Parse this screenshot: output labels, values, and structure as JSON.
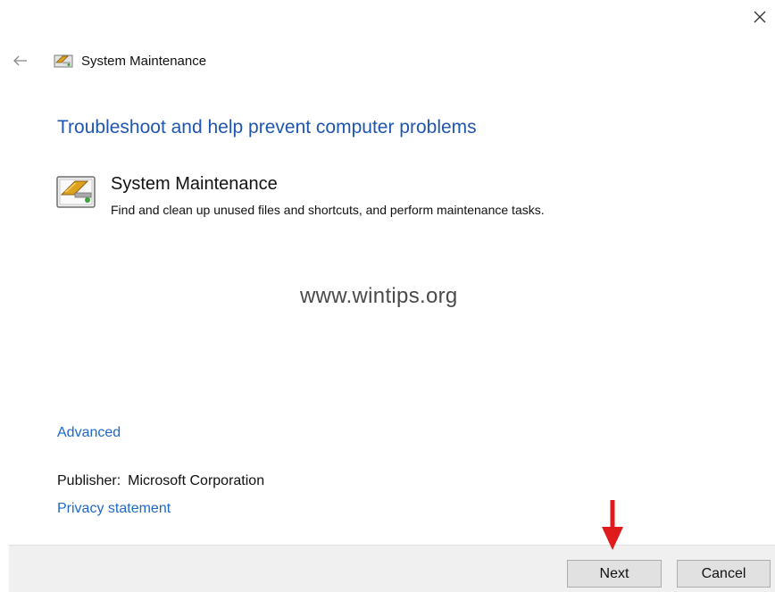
{
  "window": {
    "title": "System Maintenance",
    "close_icon": "close-icon",
    "back_icon": "back-arrow-icon",
    "title_icon": "system-maintenance-icon"
  },
  "main": {
    "heading": "Troubleshoot and help prevent computer problems",
    "tool": {
      "icon": "system-maintenance-icon",
      "name": "System Maintenance",
      "description": "Find and clean up unused files and shortcuts, and perform maintenance tasks."
    },
    "watermark": "www.wintips.org",
    "advanced_link": "Advanced",
    "publisher_label": "Publisher:",
    "publisher_value": "Microsoft Corporation",
    "privacy_link": "Privacy statement"
  },
  "footer": {
    "next_label": "Next",
    "cancel_label": "Cancel"
  },
  "colors": {
    "heading": "#1f56b0",
    "link": "#1f68c7",
    "annotation_arrow": "#e01b1b"
  }
}
